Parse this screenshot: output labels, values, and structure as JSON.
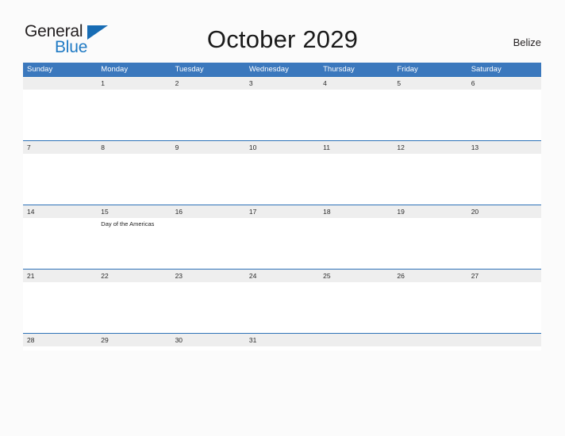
{
  "header": {
    "logo_general": "General",
    "logo_blue": "Blue",
    "title": "October 2029",
    "country": "Belize"
  },
  "calendar": {
    "weekdays": [
      "Sunday",
      "Monday",
      "Tuesday",
      "Wednesday",
      "Thursday",
      "Friday",
      "Saturday"
    ],
    "colors": {
      "header_blue": "#3b78bd",
      "row_rule_blue": "#2e72b8",
      "day_band_gray": "#eeeeee",
      "page_background": "#fbfbfb",
      "logo_blue": "#1f7ac4"
    },
    "weeks": [
      [
        {
          "day": "",
          "events": []
        },
        {
          "day": "1",
          "events": []
        },
        {
          "day": "2",
          "events": []
        },
        {
          "day": "3",
          "events": []
        },
        {
          "day": "4",
          "events": []
        },
        {
          "day": "5",
          "events": []
        },
        {
          "day": "6",
          "events": []
        }
      ],
      [
        {
          "day": "7",
          "events": []
        },
        {
          "day": "8",
          "events": []
        },
        {
          "day": "9",
          "events": []
        },
        {
          "day": "10",
          "events": []
        },
        {
          "day": "11",
          "events": []
        },
        {
          "day": "12",
          "events": []
        },
        {
          "day": "13",
          "events": []
        }
      ],
      [
        {
          "day": "14",
          "events": []
        },
        {
          "day": "15",
          "events": [
            "Day of the Americas"
          ]
        },
        {
          "day": "16",
          "events": []
        },
        {
          "day": "17",
          "events": []
        },
        {
          "day": "18",
          "events": []
        },
        {
          "day": "19",
          "events": []
        },
        {
          "day": "20",
          "events": []
        }
      ],
      [
        {
          "day": "21",
          "events": []
        },
        {
          "day": "22",
          "events": []
        },
        {
          "day": "23",
          "events": []
        },
        {
          "day": "24",
          "events": []
        },
        {
          "day": "25",
          "events": []
        },
        {
          "day": "26",
          "events": []
        },
        {
          "day": "27",
          "events": []
        }
      ],
      [
        {
          "day": "28",
          "events": []
        },
        {
          "day": "29",
          "events": []
        },
        {
          "day": "30",
          "events": []
        },
        {
          "day": "31",
          "events": []
        },
        {
          "day": "",
          "events": []
        },
        {
          "day": "",
          "events": []
        },
        {
          "day": "",
          "events": []
        }
      ]
    ]
  }
}
